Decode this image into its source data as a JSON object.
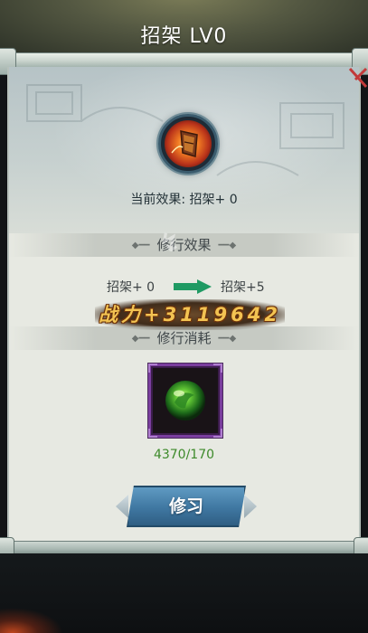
{
  "title": "招架 LV0",
  "current_effect": "当前效果: 招架+ 0",
  "sections": {
    "training_effect": "修行效果",
    "training_cost": "修行消耗"
  },
  "effect": {
    "from": "招架+ 0",
    "to": "招架+5"
  },
  "combat_power": {
    "label": "战力",
    "value": "+3119642"
  },
  "material": {
    "icon": "green-jade-orb-icon",
    "count": "4370/170"
  },
  "train_button": {
    "label": "修习"
  },
  "icons": {
    "skill": "parry-shield-icon",
    "arrow": "arrow-right-icon",
    "close": "close-icon"
  },
  "colors": {
    "arrow": "#1f9a63",
    "count_text": "#3d8a2a",
    "power_text": "#f3c352",
    "slot_border": "#7a3e9e",
    "close_x": "#c23a3a"
  }
}
